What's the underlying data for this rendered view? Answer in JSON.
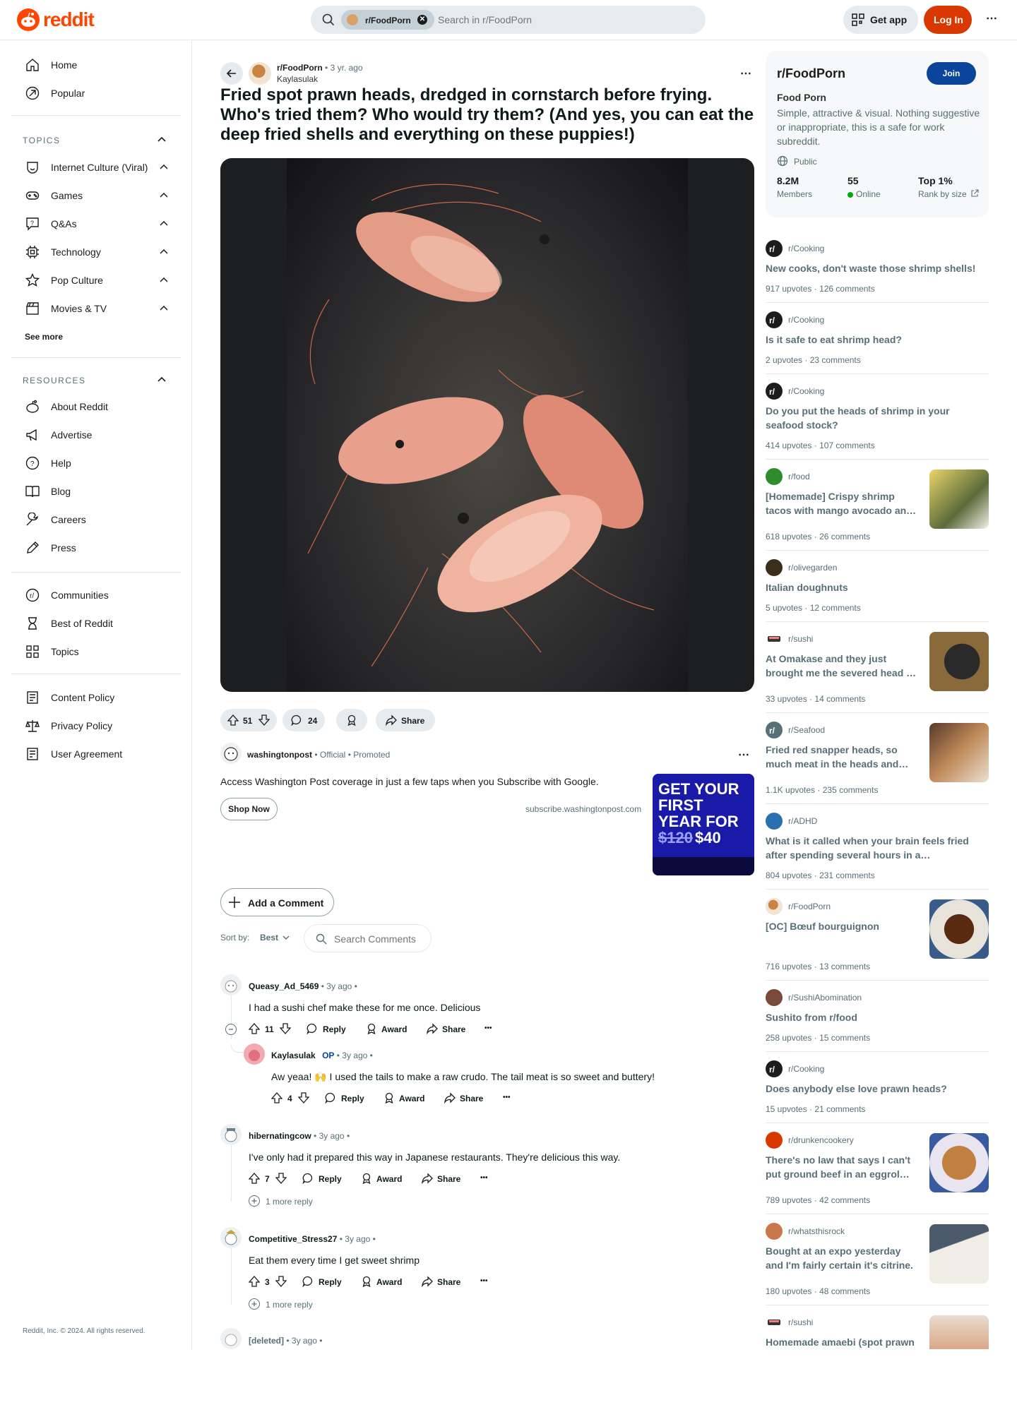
{
  "header": {
    "logo_text": "reddit",
    "search_chip": "r/FoodPorn",
    "search_placeholder": "Search in r/FoodPorn",
    "get_app": "Get app",
    "log_in": "Log In",
    "brand_color": "#ff4500"
  },
  "leftnav": {
    "home": "Home",
    "popular": "Popular",
    "topics_title": "TOPICS",
    "topics": [
      "Internet Culture (Viral)",
      "Games",
      "Q&As",
      "Technology",
      "Pop Culture",
      "Movies & TV"
    ],
    "see_more": "See more",
    "resources_title": "RESOURCES",
    "resources": [
      "About Reddit",
      "Advertise",
      "Help",
      "Blog",
      "Careers",
      "Press"
    ],
    "extra": [
      "Communities",
      "Best of Reddit",
      "Topics"
    ],
    "legal": [
      "Content Policy",
      "Privacy Policy",
      "User Agreement"
    ],
    "footer": "Reddit, Inc. © 2024. All rights reserved."
  },
  "post": {
    "subreddit": "r/FoodPorn",
    "time": "3 yr. ago",
    "author": "Kaylasulak",
    "title": "Fried spot prawn heads, dredged in cornstarch before frying. Who's tried them? Who would try them? (And yes, you can eat the deep fried shells and everything on these puppies!)",
    "votes": "51",
    "comments": "24",
    "share": "Share"
  },
  "ad": {
    "advertiser": "washingtonpost",
    "official": "Official",
    "promoted": "Promoted",
    "text": "Access Washington Post coverage in just a few taps when you Subscribe with Google.",
    "cta": "Shop Now",
    "domain": "subscribe.washingtonpost.com",
    "img_line1": "GET YOUR",
    "img_line2": "FIRST",
    "img_line3": "YEAR FOR",
    "img_old_price": "$120",
    "img_new_price": "$40"
  },
  "comments_bar": {
    "add_comment": "Add a Comment",
    "sort_label": "Sort by:",
    "sort_value": "Best",
    "search_placeholder": "Search Comments"
  },
  "comments": [
    {
      "user": "Queasy_Ad_5469",
      "time": "3y ago",
      "text": "I had a sushi chef make these for me once. Delicious",
      "votes": "11"
    },
    {
      "user": "Kaylasulak",
      "op": "OP",
      "time": "3y ago",
      "text": "Aw yeaa! 🙌 I used the tails to make a raw crudo. The tail meat is so sweet and buttery!",
      "votes": "4"
    },
    {
      "user": "hibernatingcow",
      "time": "3y ago",
      "text": "I've only had it prepared this way in Japanese restaurants. They're delicious this way.",
      "votes": "7",
      "more": "1 more reply"
    },
    {
      "user": "Competitive_Stress27",
      "time": "3y ago",
      "text": "Eat them every time I get sweet shrimp",
      "votes": "3",
      "more": "1 more reply"
    },
    {
      "user": "[deleted]",
      "time": "3y ago"
    }
  ],
  "comment_actions": {
    "reply": "Reply",
    "award": "Award",
    "share": "Share",
    "more": "•••"
  },
  "community": {
    "name": "r/FoodPorn",
    "join": "Join",
    "title": "Food Porn",
    "description": "Simple, attractive & visual. Nothing suggestive or inappropriate, this is a safe for work subreddit.",
    "visibility": "Public",
    "members": "8.2M",
    "members_label": "Members",
    "online": "55",
    "online_label": "Online",
    "rank": "Top 1%",
    "rank_label": "Rank by size"
  },
  "related": [
    {
      "sub": "r/Cooking",
      "title": "New cooks, don't waste those shrimp shells!",
      "upvotes": "917 upvotes",
      "comments": "126 comments"
    },
    {
      "sub": "r/Cooking",
      "title": "Is it safe to eat shrimp head?",
      "upvotes": "2 upvotes",
      "comments": "23 comments"
    },
    {
      "sub": "r/Cooking",
      "title": "Do you put the heads of shrimp in your seafood stock?",
      "upvotes": "414 upvotes",
      "comments": "107 comments"
    },
    {
      "sub": "r/food",
      "title": "[Homemade] Crispy shrimp tacos with mango avocado an…",
      "upvotes": "618 upvotes",
      "comments": "26 comments"
    },
    {
      "sub": "r/olivegarden",
      "title": "Italian doughnuts",
      "upvotes": "5 upvotes",
      "comments": "12 comments"
    },
    {
      "sub": "r/sushi",
      "title": "At Omakase and they just brought me the severed head …",
      "upvotes": "33 upvotes",
      "comments": "14 comments"
    },
    {
      "sub": "r/Seafood",
      "title": "Fried red snapper heads, so much meat in the heads and…",
      "upvotes": "1.1K upvotes",
      "comments": "235 comments"
    },
    {
      "sub": "r/ADHD",
      "title": "What is it called when your brain feels fried after spending several hours in a…",
      "upvotes": "804 upvotes",
      "comments": "231 comments"
    },
    {
      "sub": "r/FoodPorn",
      "title": "[OC] Bœuf bourguignon",
      "upvotes": "716 upvotes",
      "comments": "13 comments"
    },
    {
      "sub": "r/SushiAbomination",
      "title": "Sushito from r/food",
      "upvotes": "258 upvotes",
      "comments": "15 comments"
    },
    {
      "sub": "r/Cooking",
      "title": "Does anybody else love prawn heads?",
      "upvotes": "15 upvotes",
      "comments": "21 comments"
    },
    {
      "sub": "r/drunkencookery",
      "title": "There's no law that says I can't put ground beef in an eggrol…",
      "upvotes": "789 upvotes",
      "comments": "42 comments"
    },
    {
      "sub": "r/whatsthisrock",
      "title": "Bought at an expo yesterday and I'm fairly certain it's citrine.",
      "upvotes": "180 upvotes",
      "comments": "48 comments"
    },
    {
      "sub": "r/sushi",
      "title": "Homemade amaebi (spot prawn"
    }
  ]
}
